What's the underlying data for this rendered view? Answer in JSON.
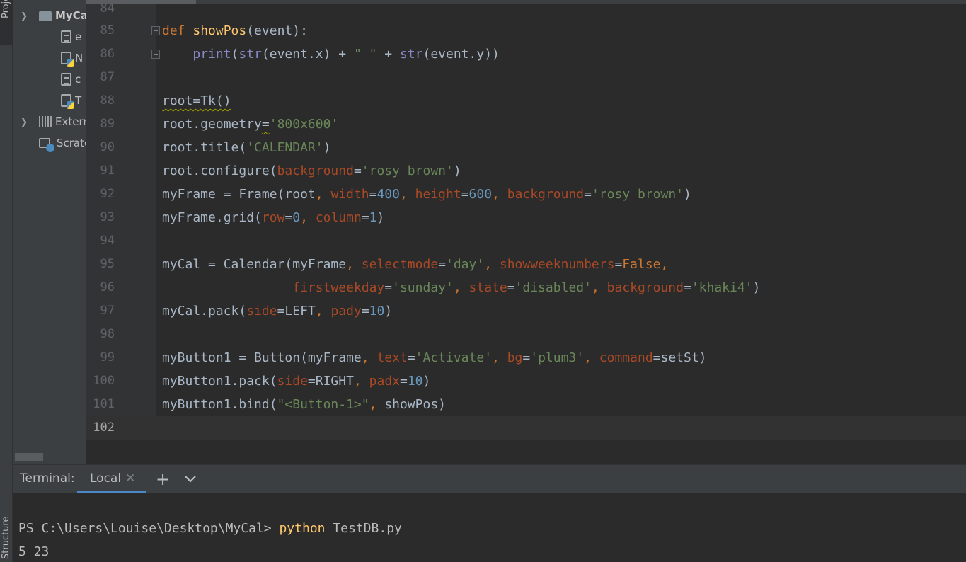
{
  "tool_windows": {
    "project_label": "Project",
    "structure_label": "Structure"
  },
  "project_tree": {
    "root": "MyCal",
    "items": [
      "e",
      "N",
      "c",
      "T"
    ],
    "external": "External Libraries",
    "scratches": "Scratches and Consoles"
  },
  "editor": {
    "lines": [
      {
        "n": "84"
      },
      {
        "n": "85"
      },
      {
        "n": "86"
      },
      {
        "n": "87"
      },
      {
        "n": "88"
      },
      {
        "n": "89"
      },
      {
        "n": "90"
      },
      {
        "n": "91"
      },
      {
        "n": "92"
      },
      {
        "n": "93"
      },
      {
        "n": "94"
      },
      {
        "n": "95"
      },
      {
        "n": "96"
      },
      {
        "n": "97"
      },
      {
        "n": "98"
      },
      {
        "n": "99"
      },
      {
        "n": "100"
      },
      {
        "n": "101"
      },
      {
        "n": "102"
      }
    ]
  },
  "terminal": {
    "label": "Terminal:",
    "tab": "Local",
    "prompt": "PS C:\\Users\\Louise\\Desktop\\MyCal> ",
    "command": "python",
    "args": " TestDB.py",
    "output": "5 23"
  },
  "colors": {
    "keyword": "#cc7832",
    "function": "#ffc66d",
    "string": "#6a8759",
    "number": "#6897bb",
    "param": "#aa4926",
    "builtin": "#8888c6",
    "accent": "#4a88c7"
  }
}
